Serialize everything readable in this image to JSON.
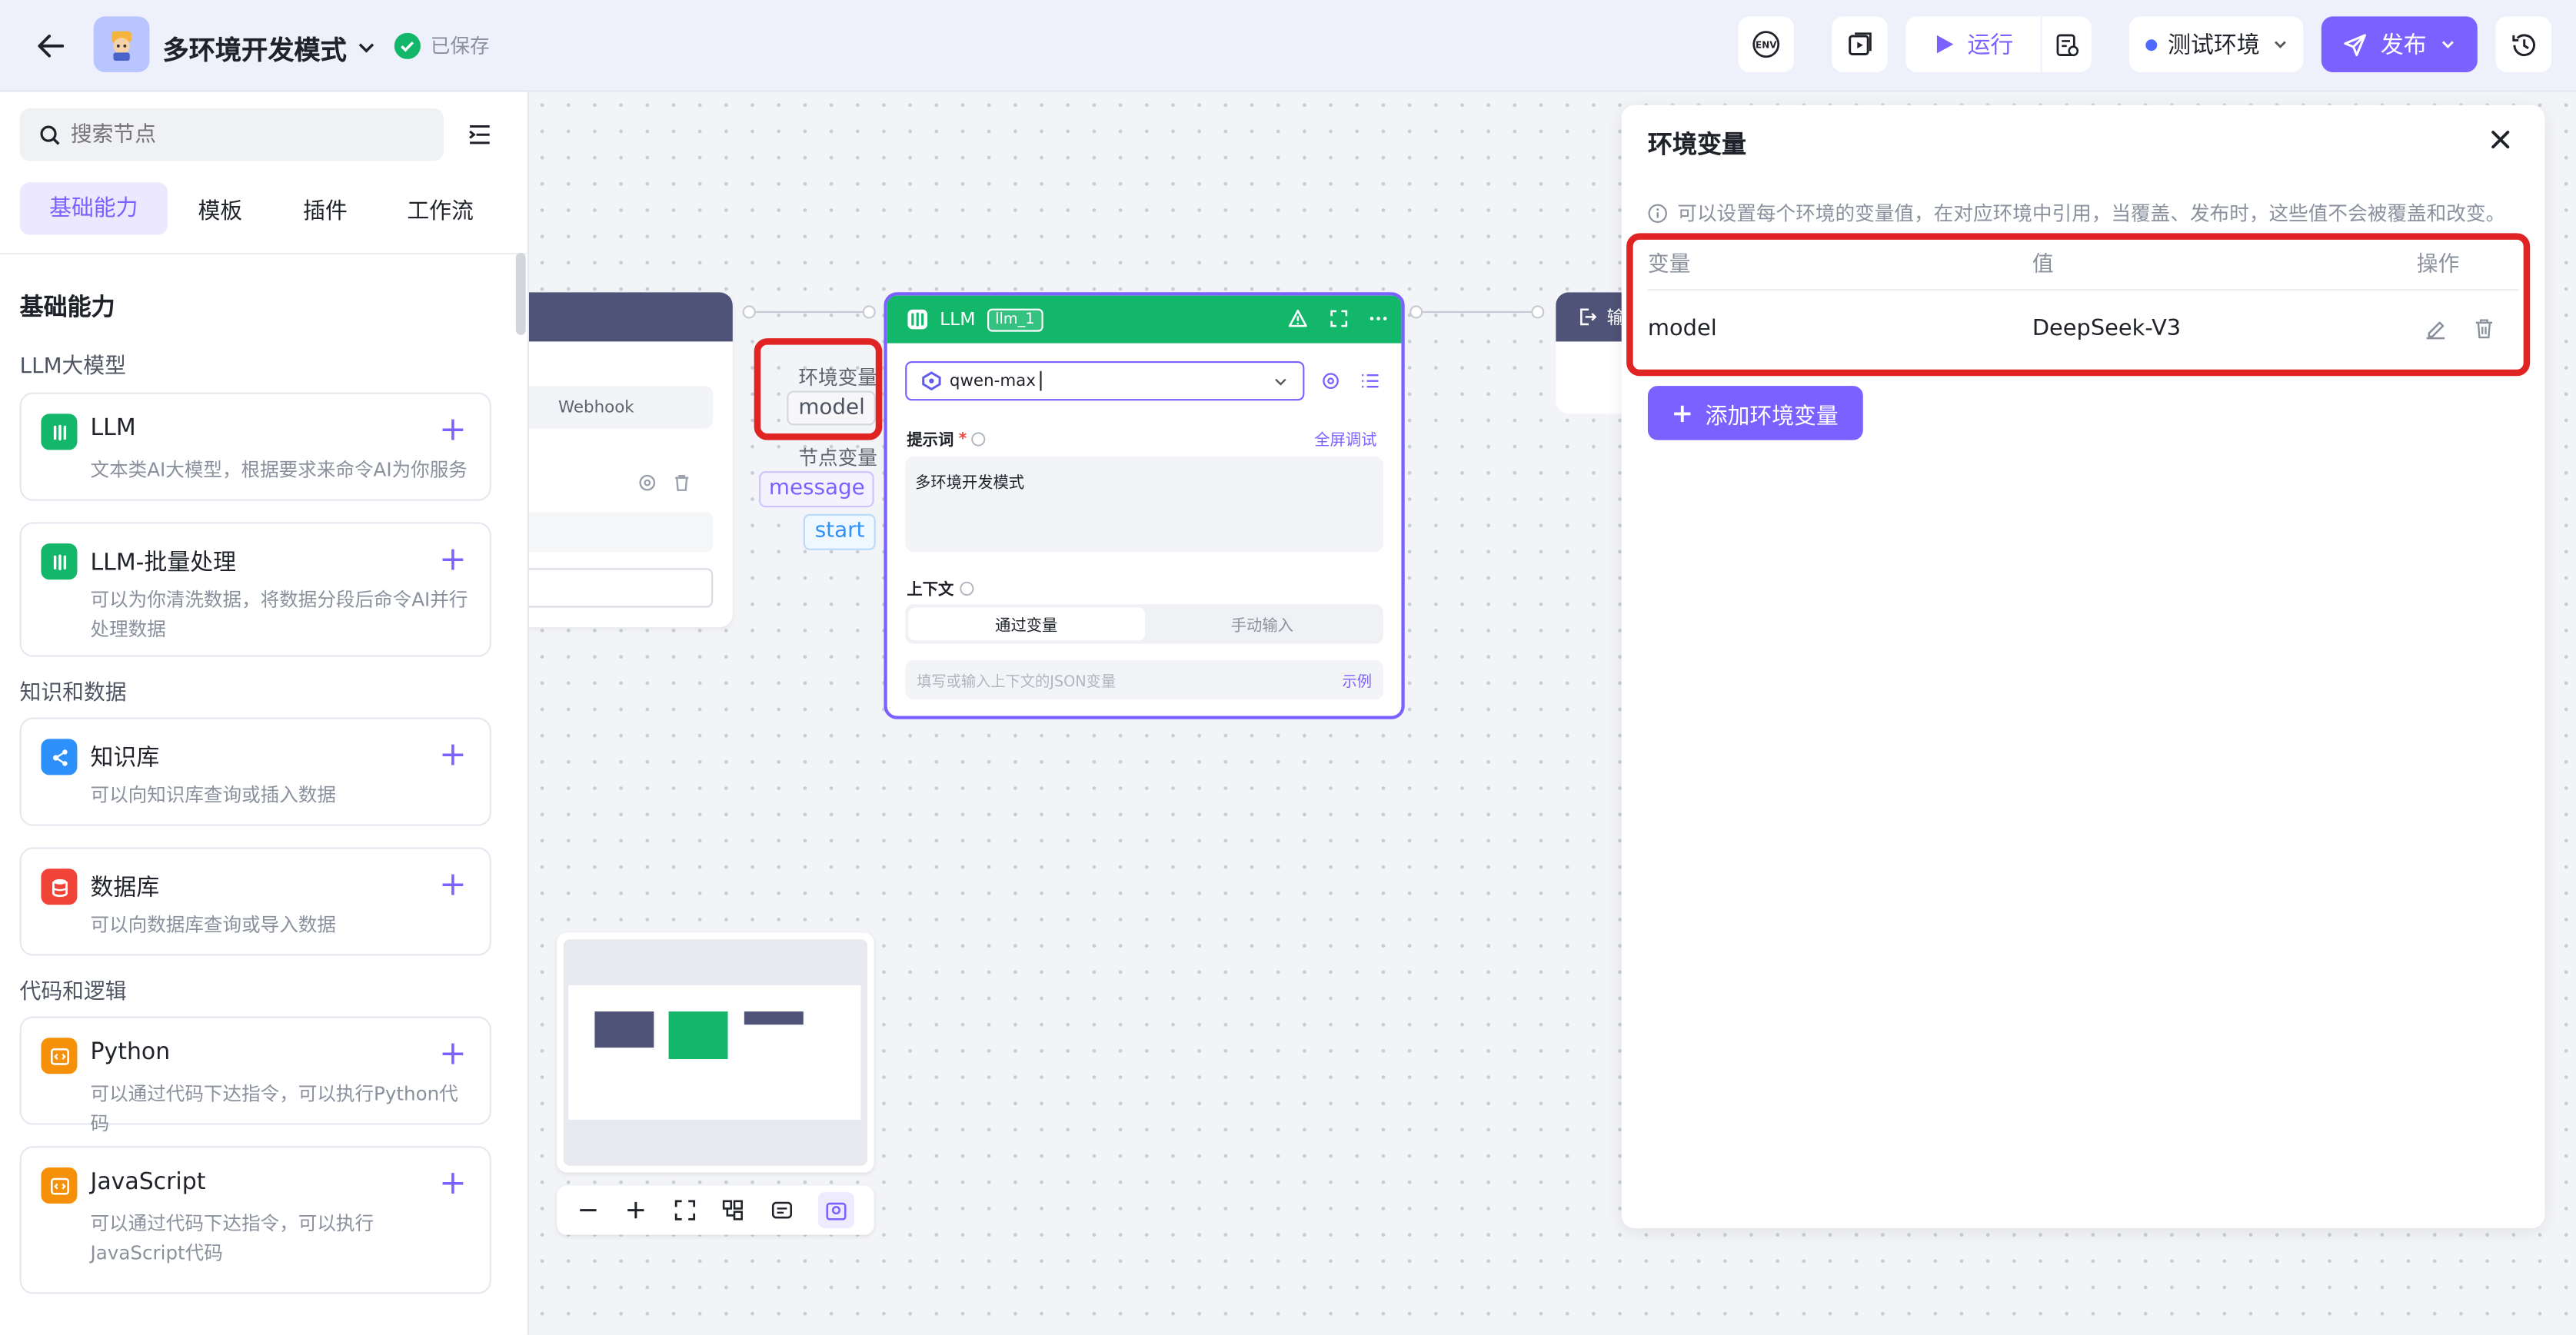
{
  "header": {
    "title": "多环境开发模式",
    "save_status": "已保存",
    "run_label": "运行",
    "env_select": "测试环境",
    "publish_label": "发布",
    "env_icon_text": "ENV"
  },
  "sidebar": {
    "search_placeholder": "搜索节点",
    "tabs": [
      "基础能力",
      "模板",
      "插件",
      "工作流"
    ],
    "section_title": "基础能力",
    "groups": [
      {
        "title": "LLM大模型"
      },
      {
        "title": "知识和数据"
      },
      {
        "title": "代码和逻辑"
      }
    ],
    "items": [
      {
        "name": "LLM",
        "desc": "文本类AI大模型，根据要求来命令AI为你服务",
        "color": "#12b76a"
      },
      {
        "name": "LLM-批量处理",
        "desc": "可以为你清洗数据，将数据分段后命令AI并行处理数据",
        "color": "#12b76a"
      },
      {
        "name": "知识库",
        "desc": "可以向知识库查询或插入数据",
        "color": "#2e90fa"
      },
      {
        "name": "数据库",
        "desc": "可以向数据库查询或导入数据",
        "color": "#f04438"
      },
      {
        "name": "Python",
        "desc": "可以通过代码下达指令，可以执行Python代码",
        "color": "#f79009"
      },
      {
        "name": "JavaScript",
        "desc": "可以通过代码下达指令，可以执行JavaScript代码",
        "color": "#f79009"
      }
    ]
  },
  "canvas": {
    "start_node": {
      "webhook_label": "Webhook"
    },
    "variables": {
      "env_label": "环境变量",
      "env_value": "model",
      "node_label": "节点变量",
      "node_value_1": "message",
      "node_value_2": "start"
    },
    "llm_node": {
      "title": "LLM",
      "id_badge": "llm_1",
      "model": "qwen-max",
      "prompt_label": "提示词",
      "fullscreen_label": "全屏调试",
      "prompt_text": "多环境开发模式",
      "context_label": "上下文",
      "tab_variable": "通过变量",
      "tab_manual": "手动输入",
      "json_placeholder": "填写或输入上下文的JSON变量",
      "example_label": "示例"
    },
    "output_node": {
      "title": "输"
    }
  },
  "env_panel": {
    "title": "环境变量",
    "hint": "可以设置每个环境的变量值，在对应环境中引用，当覆盖、发布时，这些值不会被覆盖和改变。",
    "columns": [
      "变量",
      "值",
      "操作"
    ],
    "rows": [
      {
        "name": "model",
        "value": "DeepSeek-V3"
      }
    ],
    "add_label": "添加环境变量"
  },
  "colors": {
    "accent": "#7b61ff",
    "green": "#12b76a",
    "highlight": "#e02424",
    "node_header_dark": "#4e5377"
  }
}
